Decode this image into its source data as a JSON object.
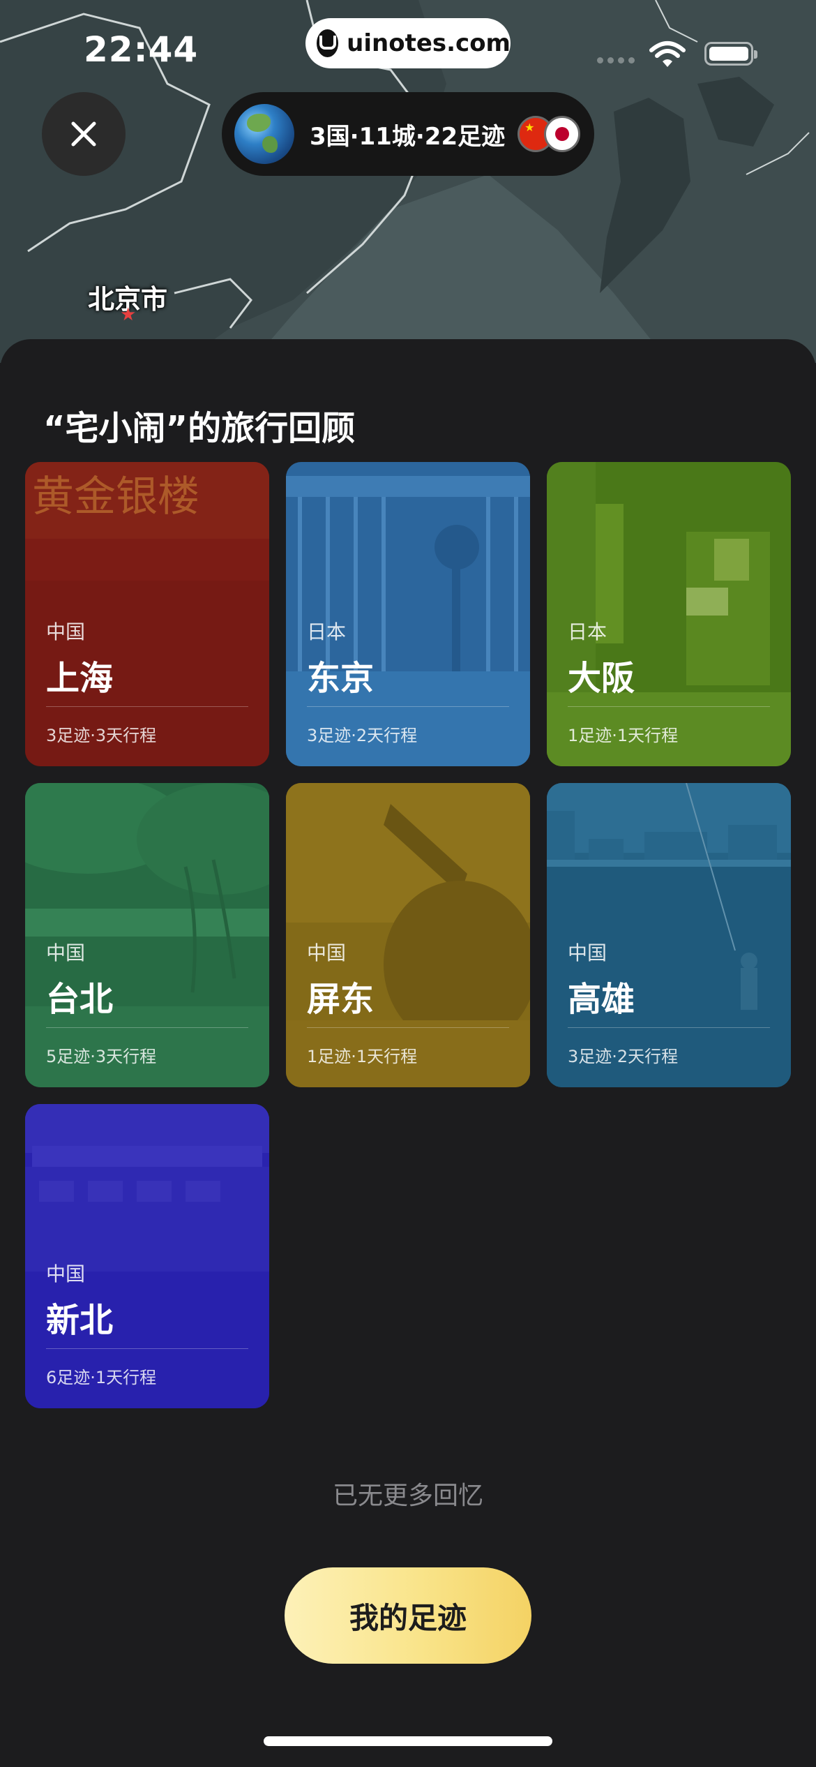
{
  "status_bar": {
    "time": "22:44"
  },
  "browser": {
    "url": "uinotes.com"
  },
  "header": {
    "stats": "3国·11城·22足迹",
    "map_city_label": "北京市",
    "flags": [
      "china-flag-icon",
      "japan-flag-icon"
    ]
  },
  "review": {
    "title": "“宅小闹”的旅行回顾",
    "cards": [
      {
        "country": "中国",
        "city": "上海",
        "meta": "3足迹·3天行程",
        "tint": "#8a1e16",
        "photo": "gold-bank-building"
      },
      {
        "country": "日本",
        "city": "东京",
        "meta": "3足迹·2天行程",
        "tint": "#2f72b0",
        "photo": "gate-lamp"
      },
      {
        "country": "日本",
        "city": "大阪",
        "meta": "1足迹·1天行程",
        "tint": "#55861c",
        "photo": "street-signs"
      },
      {
        "country": "中国",
        "city": "台北",
        "meta": "5足迹·3天行程",
        "tint": "#2d7a4d",
        "photo": "tree-park"
      },
      {
        "country": "中国",
        "city": "屏东",
        "meta": "1足迹·1天行程",
        "tint": "#8f7218",
        "photo": "bird-sculpture"
      },
      {
        "country": "中国",
        "city": "高雄",
        "meta": "3足迹·2天行程",
        "tint": "#205a7c",
        "photo": "harbor-fisher"
      },
      {
        "country": "中国",
        "city": "新北",
        "meta": "6足迹·1天行程",
        "tint": "#2a22b4",
        "photo": "ferry-building"
      }
    ],
    "no_more": "已无更多回忆",
    "footprint_button": "我的足迹"
  }
}
